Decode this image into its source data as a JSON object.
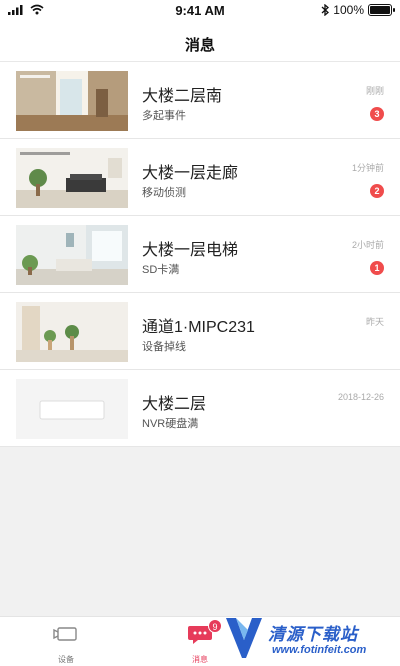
{
  "status_bar": {
    "time": "9:41 AM",
    "battery_text": "100%",
    "battery_level": 1.0,
    "signal_icon": "signal-bars-icon",
    "wifi_icon": "wifi-icon",
    "bluetooth_icon": "bluetooth-icon"
  },
  "nav": {
    "title": "消息"
  },
  "messages": [
    {
      "title": "大楼二层南",
      "subtitle": "多起事件",
      "time": "刚刚",
      "badge": "3"
    },
    {
      "title": "大楼一层走廊",
      "subtitle": "移动侦测",
      "time": "1分钟前",
      "badge": "2"
    },
    {
      "title": "大楼一层电梯",
      "subtitle": "SD卡满",
      "time": "2小时前",
      "badge": "1"
    },
    {
      "title": "通道1·MIPC231",
      "subtitle": "设备掉线",
      "time": "昨天",
      "badge": ""
    },
    {
      "title": "大楼二层",
      "subtitle": "NVR硬盘满",
      "time": "2018-12-26",
      "badge": ""
    }
  ],
  "tabbar": {
    "devices_label": "设备",
    "messages_label": "消息",
    "messages_badge": "9",
    "devices_icon": "camera-icon",
    "messages_icon": "chat-bubble-icon"
  },
  "watermark": {
    "text": "清源下载站",
    "url": "www.fotinfeit.com"
  },
  "colors": {
    "accent": "#e63b5a",
    "badge": "#f04c4c",
    "watermark": "#2a5fc9"
  }
}
